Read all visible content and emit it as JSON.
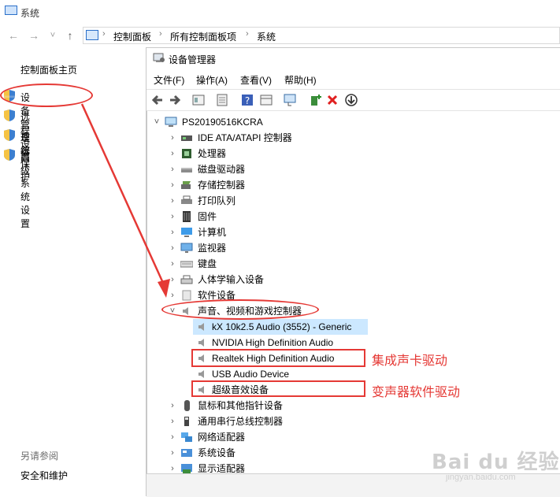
{
  "window": {
    "title": "系统"
  },
  "nav": {
    "back": "←",
    "forward": "→",
    "dropdown": "˅",
    "up": "↑",
    "breadcrumb": [
      "控制面板",
      "所有控制面板项",
      "系统"
    ],
    "separator": "›"
  },
  "left_panel": {
    "home": "控制面板主页",
    "links": [
      "设备管理器",
      "远程设置",
      "系统保护",
      "高级系统设置"
    ],
    "see_also_label": "另请参阅",
    "see_also": [
      "安全和维护"
    ]
  },
  "device_manager": {
    "title": "设备管理器",
    "menu": [
      "文件(F)",
      "操作(A)",
      "查看(V)",
      "帮助(H)"
    ],
    "toolbar": [
      "back-icon",
      "forward-icon",
      "properties-icon",
      "update-icon",
      "help-icon",
      "view-icon",
      "scan-icon",
      "add-driver-icon",
      "uninstall-icon",
      "download-icon"
    ],
    "root": "PS20190516KCRA",
    "categories_top": [
      {
        "label": "IDE ATA/ATAPI 控制器",
        "icon": "ide-icon"
      },
      {
        "label": "处理器",
        "icon": "cpu-icon"
      },
      {
        "label": "磁盘驱动器",
        "icon": "disk-icon"
      },
      {
        "label": "存储控制器",
        "icon": "storage-icon"
      },
      {
        "label": "打印队列",
        "icon": "printer-icon"
      },
      {
        "label": "固件",
        "icon": "firmware-icon"
      },
      {
        "label": "计算机",
        "icon": "computer-icon"
      },
      {
        "label": "监视器",
        "icon": "monitor-icon"
      },
      {
        "label": "键盘",
        "icon": "keyboard-icon"
      },
      {
        "label": "人体学输入设备",
        "icon": "hid-icon"
      },
      {
        "label": "软件设备",
        "icon": "software-icon"
      }
    ],
    "expanded_category": "声音、视频和游戏控制器",
    "audio_devices": [
      "kX 10k2.5 Audio (3552) - Generic",
      "NVIDIA High Definition Audio",
      "Realtek High Definition Audio",
      "USB Audio Device",
      "超级音效设备"
    ],
    "categories_bottom": [
      {
        "label": "鼠标和其他指针设备",
        "icon": "mouse-icon"
      },
      {
        "label": "通用串行总线控制器",
        "icon": "usb-icon"
      },
      {
        "label": "网络适配器",
        "icon": "network-icon"
      },
      {
        "label": "系统设备",
        "icon": "system-device-icon"
      },
      {
        "label": "显示适配器",
        "icon": "display-adapter-icon"
      }
    ]
  },
  "annotations": {
    "realtek_note": "集成声卡驱动",
    "voice_changer_note": "变声器软件驱动"
  },
  "watermark": {
    "brand": "Bai du 经验",
    "url": "jingyan.baidu.com"
  },
  "colors": {
    "annotation": "#e53935",
    "selection": "#cce8ff",
    "link_blue": "#1e6fc4"
  }
}
